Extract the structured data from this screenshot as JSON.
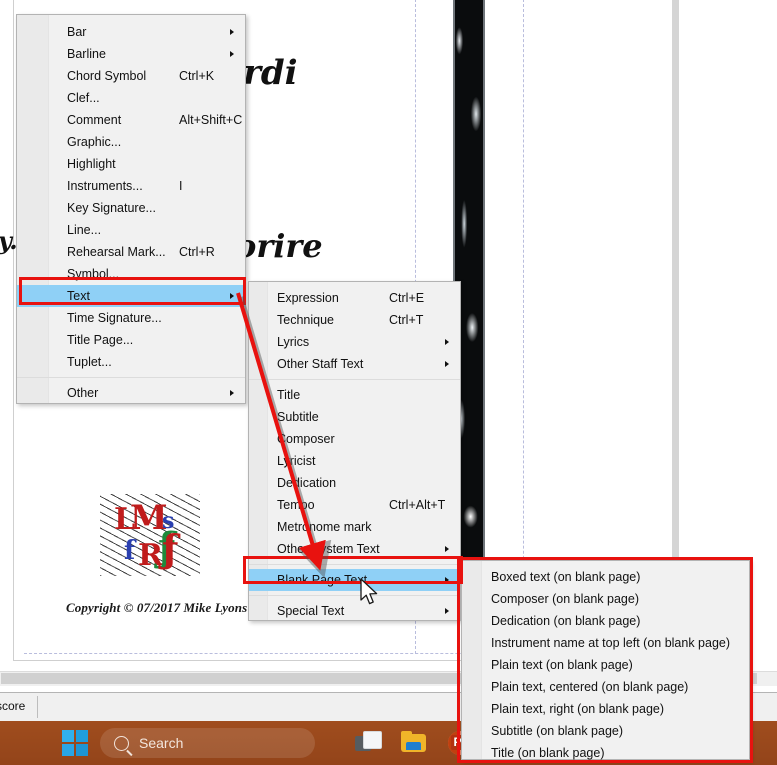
{
  "document": {
    "script_text_1": "rdi",
    "script_text_2": "orire",
    "script_text_3": "y.",
    "copyright": "Copyright © 07/2017 Mike Lyons",
    "logo": {
      "l": "L",
      "m": "M",
      "s": "s",
      "f": "f",
      "r": "R",
      "g": "ƒ"
    }
  },
  "statusbar": {
    "label": "score"
  },
  "menu1": {
    "name": "Add menu",
    "items": [
      {
        "label": "Bar",
        "accel": "",
        "submenu": true,
        "selected": false
      },
      {
        "label": "Barline",
        "accel": "",
        "submenu": true,
        "selected": false
      },
      {
        "label": "Chord Symbol",
        "accel": "Ctrl+K",
        "submenu": false,
        "selected": false
      },
      {
        "label": "Clef...",
        "accel": "",
        "submenu": false,
        "selected": false
      },
      {
        "label": "Comment",
        "accel": "Alt+Shift+C",
        "submenu": false,
        "selected": false
      },
      {
        "label": "Graphic...",
        "accel": "",
        "submenu": false,
        "selected": false
      },
      {
        "label": "Highlight",
        "accel": "",
        "submenu": false,
        "selected": false
      },
      {
        "label": "Instruments...",
        "accel": "I",
        "submenu": false,
        "selected": false
      },
      {
        "label": "Key Signature...",
        "accel": "",
        "submenu": false,
        "selected": false
      },
      {
        "label": "Line...",
        "accel": "",
        "submenu": false,
        "selected": false
      },
      {
        "label": "Rehearsal Mark...",
        "accel": "Ctrl+R",
        "submenu": false,
        "selected": false
      },
      {
        "label": "Symbol...",
        "accel": "",
        "submenu": false,
        "selected": false
      },
      {
        "label": "Text",
        "accel": "",
        "submenu": true,
        "selected": true
      },
      {
        "label": "Time Signature...",
        "accel": "",
        "submenu": false,
        "selected": false
      },
      {
        "label": "Title Page...",
        "accel": "",
        "submenu": false,
        "selected": false
      },
      {
        "label": "Tuplet...",
        "accel": "",
        "submenu": false,
        "selected": false
      },
      {
        "separator": true
      },
      {
        "label": "Other",
        "accel": "",
        "submenu": true,
        "selected": false
      }
    ]
  },
  "menu2": {
    "name": "Text submenu",
    "items": [
      {
        "label": "Expression",
        "accel": "Ctrl+E",
        "submenu": false,
        "selected": false
      },
      {
        "label": "Technique",
        "accel": "Ctrl+T",
        "submenu": false,
        "selected": false
      },
      {
        "label": "Lyrics",
        "accel": "",
        "submenu": true,
        "selected": false
      },
      {
        "label": "Other Staff Text",
        "accel": "",
        "submenu": true,
        "selected": false
      },
      {
        "separator": true
      },
      {
        "label": "Title",
        "accel": "",
        "submenu": false,
        "selected": false
      },
      {
        "label": "Subtitle",
        "accel": "",
        "submenu": false,
        "selected": false
      },
      {
        "label": "Composer",
        "accel": "",
        "submenu": false,
        "selected": false
      },
      {
        "label": "Lyricist",
        "accel": "",
        "submenu": false,
        "selected": false
      },
      {
        "label": "Dedication",
        "accel": "",
        "submenu": false,
        "selected": false
      },
      {
        "label": "Tempo",
        "accel": "Ctrl+Alt+T",
        "submenu": false,
        "selected": false
      },
      {
        "label": "Metronome mark",
        "accel": "",
        "submenu": false,
        "selected": false
      },
      {
        "label": "Other System Text",
        "accel": "",
        "submenu": true,
        "selected": false
      },
      {
        "separator": true
      },
      {
        "label": "Blank Page Text",
        "accel": "",
        "submenu": true,
        "selected": true
      },
      {
        "separator": true
      },
      {
        "label": "Special Text",
        "accel": "",
        "submenu": true,
        "selected": false
      }
    ]
  },
  "menu3": {
    "name": "Blank Page Text submenu",
    "items": [
      {
        "label": "Boxed text (on blank page)",
        "accel": "",
        "submenu": false,
        "selected": false
      },
      {
        "label": "Composer (on blank page)",
        "accel": "",
        "submenu": false,
        "selected": false
      },
      {
        "label": "Dedication (on blank page)",
        "accel": "",
        "submenu": false,
        "selected": false
      },
      {
        "label": "Instrument name at top left (on blank page)",
        "accel": "",
        "submenu": false,
        "selected": false
      },
      {
        "label": "Plain text (on blank page)",
        "accel": "",
        "submenu": false,
        "selected": false
      },
      {
        "label": "Plain text, centered (on blank page)",
        "accel": "",
        "submenu": false,
        "selected": false
      },
      {
        "label": "Plain text, right (on blank page)",
        "accel": "",
        "submenu": false,
        "selected": false
      },
      {
        "label": "Subtitle (on blank page)",
        "accel": "",
        "submenu": false,
        "selected": false
      },
      {
        "label": "Title (on blank page)",
        "accel": "",
        "submenu": false,
        "selected": false
      }
    ]
  },
  "taskbar": {
    "search_placeholder": "Search",
    "icons": [
      "windows-start-icon",
      "search-icon",
      "task-view-icon",
      "file-explorer-icon",
      "powerpoint-icon"
    ]
  },
  "annotations": {
    "highlight_color": "#e8120f",
    "selection_color": "#8fd0f6",
    "boxes": [
      "text-menu-item",
      "blank-page-text-menu-item",
      "blank-page-text-submenu"
    ],
    "arrow": "red-arrow-from-text-to-blank-page-text"
  }
}
